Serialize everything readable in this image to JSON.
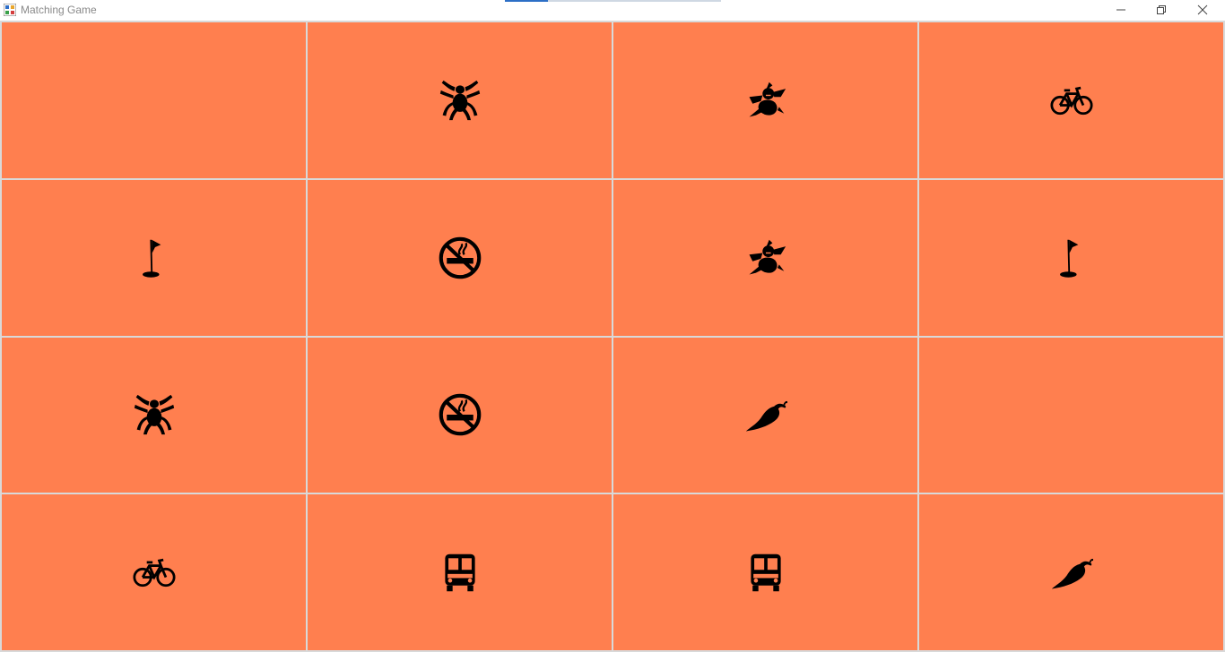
{
  "window": {
    "title": "Matching Game",
    "controls": [
      "minimize",
      "restore",
      "close"
    ]
  },
  "board": {
    "rows": 4,
    "columns": 4,
    "tile_color": "#ff7f4f",
    "tiles": [
      [
        "blank",
        "spider-icon",
        "ninja-icon",
        "bicycle-icon"
      ],
      [
        "golf-flag-icon",
        "no-smoking-icon",
        "ninja-icon",
        "golf-flag-icon"
      ],
      [
        "spider-icon",
        "no-smoking-icon",
        "chili-pepper-icon",
        "blank"
      ],
      [
        "bicycle-icon",
        "bus-icon",
        "bus-icon",
        "chili-pepper-icon"
      ]
    ]
  }
}
